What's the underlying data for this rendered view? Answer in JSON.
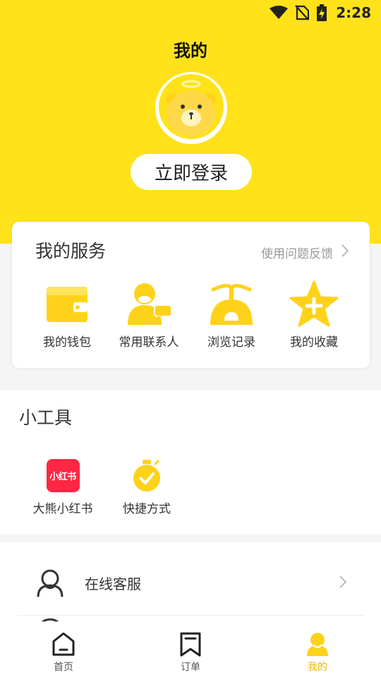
{
  "status_bar": {
    "time": "2:28",
    "icons": [
      "wifi-icon",
      "no-sim-icon",
      "battery-charging-icon"
    ]
  },
  "header": {
    "title": "我的",
    "login_label": "立即登录",
    "avatar_icon": "bear-avatar-icon"
  },
  "services": {
    "title": "我的服务",
    "feedback_label": "使用问题反馈",
    "items": [
      {
        "label": "我的钱包",
        "icon": "wallet-icon"
      },
      {
        "label": "常用联系人",
        "icon": "contacts-icon"
      },
      {
        "label": "浏览记录",
        "icon": "history-icon"
      },
      {
        "label": "我的收藏",
        "icon": "star-icon"
      }
    ]
  },
  "tools": {
    "title": "小工具",
    "items": [
      {
        "label": "大熊小红书",
        "icon": "xiaohongshu-icon",
        "logo_text": "小红书"
      },
      {
        "label": "快捷方式",
        "icon": "stopwatch-icon"
      }
    ]
  },
  "menu": {
    "items": [
      {
        "label": "在线客服",
        "icon": "customer-service-icon"
      }
    ]
  },
  "bottom_nav": {
    "items": [
      {
        "label": "首页",
        "icon": "home-icon"
      },
      {
        "label": "订单",
        "icon": "order-icon"
      },
      {
        "label": "我的",
        "icon": "profile-icon",
        "active": true
      }
    ]
  },
  "colors": {
    "brand_yellow": "#ffe21a",
    "icon_yellow": "#ffd21a",
    "active_text": "#f0b800",
    "red": "#ff2741"
  }
}
